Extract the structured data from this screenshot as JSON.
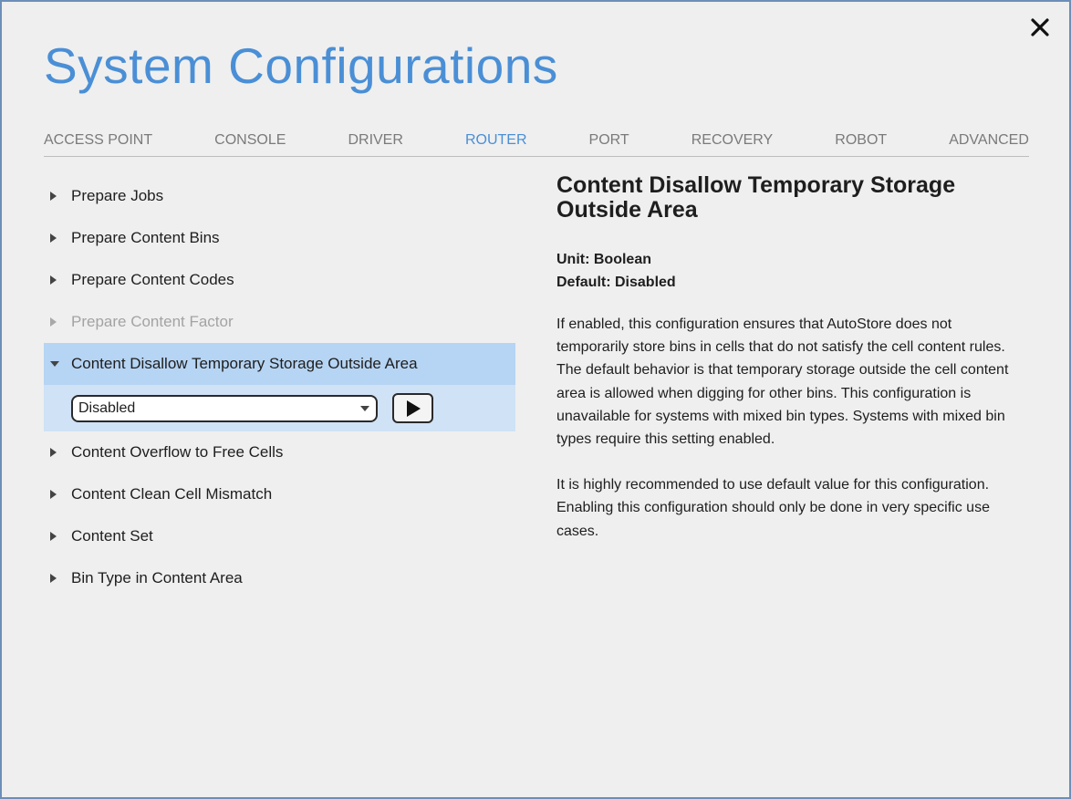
{
  "header": {
    "title": "System Configurations"
  },
  "tabs": [
    {
      "label": "ACCESS POINT",
      "active": false
    },
    {
      "label": "CONSOLE",
      "active": false
    },
    {
      "label": "DRIVER",
      "active": false
    },
    {
      "label": "ROUTER",
      "active": true
    },
    {
      "label": "PORT",
      "active": false
    },
    {
      "label": "RECOVERY",
      "active": false
    },
    {
      "label": "ROBOT",
      "active": false
    },
    {
      "label": "ADVANCED",
      "active": false
    }
  ],
  "list": {
    "items": [
      {
        "label": "Prepare Jobs",
        "state": "collapsed"
      },
      {
        "label": "Prepare Content Bins",
        "state": "collapsed"
      },
      {
        "label": "Prepare Content Codes",
        "state": "collapsed"
      },
      {
        "label": "Prepare Content Factor",
        "state": "disabled"
      },
      {
        "label": "Content Disallow Temporary Storage Outside Area",
        "state": "expanded"
      },
      {
        "label": "Content Overflow to Free Cells",
        "state": "collapsed"
      },
      {
        "label": "Content Clean Cell Mismatch",
        "state": "collapsed"
      },
      {
        "label": "Content Set",
        "state": "collapsed"
      },
      {
        "label": "Bin Type in Content Area",
        "state": "collapsed"
      }
    ],
    "expanded_control": {
      "selected_value": "Disabled",
      "dropdown_icon": "chevron-down-icon",
      "run_icon": "play-icon"
    }
  },
  "detail": {
    "title": "Content Disallow Temporary Storage Outside Area",
    "unit": "Unit: Boolean",
    "default": "Default: Disabled",
    "paragraphs": [
      "If enabled, this configuration ensures that AutoStore does not temporarily store bins in cells that do not satisfy the cell content rules. The default behavior is that temporary storage outside the cell content area is allowed when digging for other bins. This configuration is unavailable for systems with mixed bin types. Systems with mixed bin types require this setting enabled.",
      "It is highly recommended to use default value for this configuration. Enabling this configuration should only be done in very specific use cases."
    ]
  },
  "colors": {
    "title_blue": "#4a8fd6",
    "active_tab": "#4a8fd6",
    "expanded_row_bg": "#b6d4f3",
    "expanded_panel_bg": "#cfe2f6",
    "window_bg": "#efefef"
  },
  "icons": {
    "close": "close-icon",
    "caret_right": "caret-right-icon",
    "caret_down": "caret-down-icon"
  }
}
